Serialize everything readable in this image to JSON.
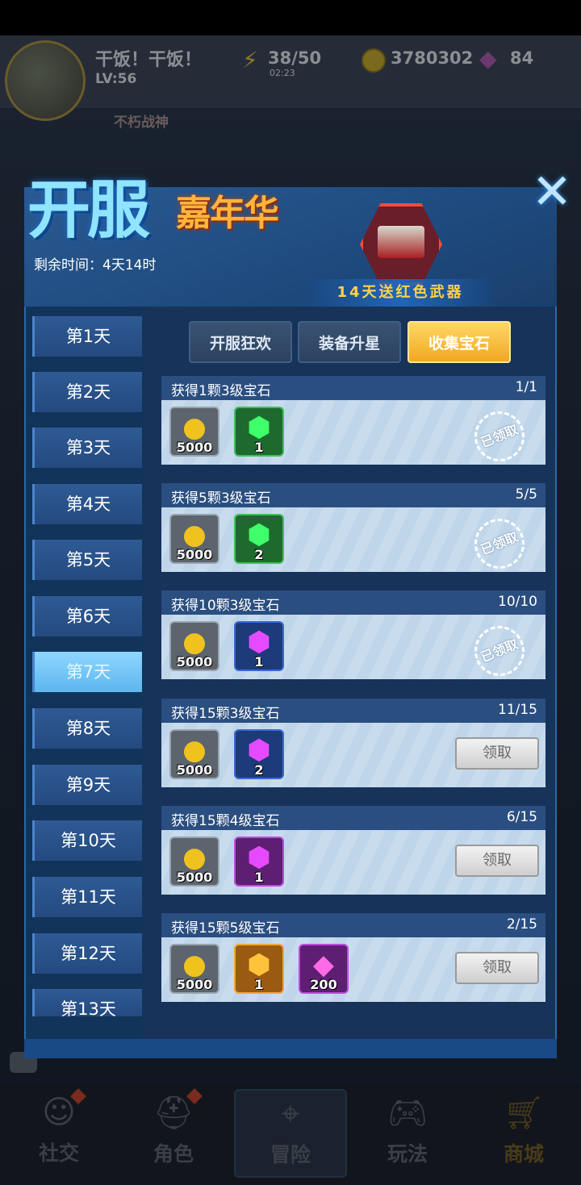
{
  "player": {
    "name": "干饭！干饭！",
    "level": "LV:56",
    "energy": "38/50",
    "energy_timer": "02:23",
    "coins": "3780302",
    "gems": "84",
    "title_badge": "不朽战神"
  },
  "event": {
    "title_main": "开服",
    "title_sub": "嘉年华",
    "remaining_time": "剩余时间：4天14时",
    "promo": "14天送红色武器",
    "close_icon": "close-icon"
  },
  "days": [
    "第1天",
    "第2天",
    "第3天",
    "第4天",
    "第5天",
    "第6天",
    "第7天",
    "第8天",
    "第9天",
    "第10天",
    "第11天",
    "第12天",
    "第13天"
  ],
  "active_day": "第7天",
  "category_tabs": [
    "开服狂欢",
    "装备升星",
    "收集宝石"
  ],
  "active_category": "收集宝石",
  "tasks": [
    {
      "title": "获得1颗3级宝石",
      "progress": "1/1",
      "rewards": [
        {
          "icon": "coin-icon",
          "qty": "5000"
        },
        {
          "icon": "green-gem-icon",
          "qty": "1"
        }
      ],
      "status": "已领取"
    },
    {
      "title": "获得5颗3级宝石",
      "progress": "5/5",
      "rewards": [
        {
          "icon": "coin-icon",
          "qty": "5000"
        },
        {
          "icon": "green-gem-icon",
          "qty": "2"
        }
      ],
      "status": "已领取"
    },
    {
      "title": "获得10颗3级宝石",
      "progress": "10/10",
      "rewards": [
        {
          "icon": "coin-icon",
          "qty": "5000"
        },
        {
          "icon": "purple-gem-icon",
          "qty": "1"
        }
      ],
      "status": "已领取"
    },
    {
      "title": "获得15颗3级宝石",
      "progress": "11/15",
      "rewards": [
        {
          "icon": "coin-icon",
          "qty": "5000"
        },
        {
          "icon": "purple-gem-icon",
          "qty": "2"
        }
      ],
      "button": "领取"
    },
    {
      "title": "获得15颗4级宝石",
      "progress": "6/15",
      "rewards": [
        {
          "icon": "coin-icon",
          "qty": "5000"
        },
        {
          "icon": "purple-gem-icon",
          "qty": "1"
        }
      ],
      "button": "领取"
    },
    {
      "title": "获得15颗5级宝石",
      "progress": "2/15",
      "rewards": [
        {
          "icon": "coin-icon",
          "qty": "5000"
        },
        {
          "icon": "orange-gem-icon",
          "qty": "1"
        },
        {
          "icon": "diamond-icon",
          "qty": "200"
        }
      ],
      "button": "领取"
    }
  ],
  "bottom_nav": [
    "社交",
    "角色",
    "冒险",
    "玩法",
    "商城"
  ],
  "colors": {
    "accent_gold": "#f0a822",
    "panel_blue": "#12345a",
    "active_day": "#8fd6ff"
  }
}
